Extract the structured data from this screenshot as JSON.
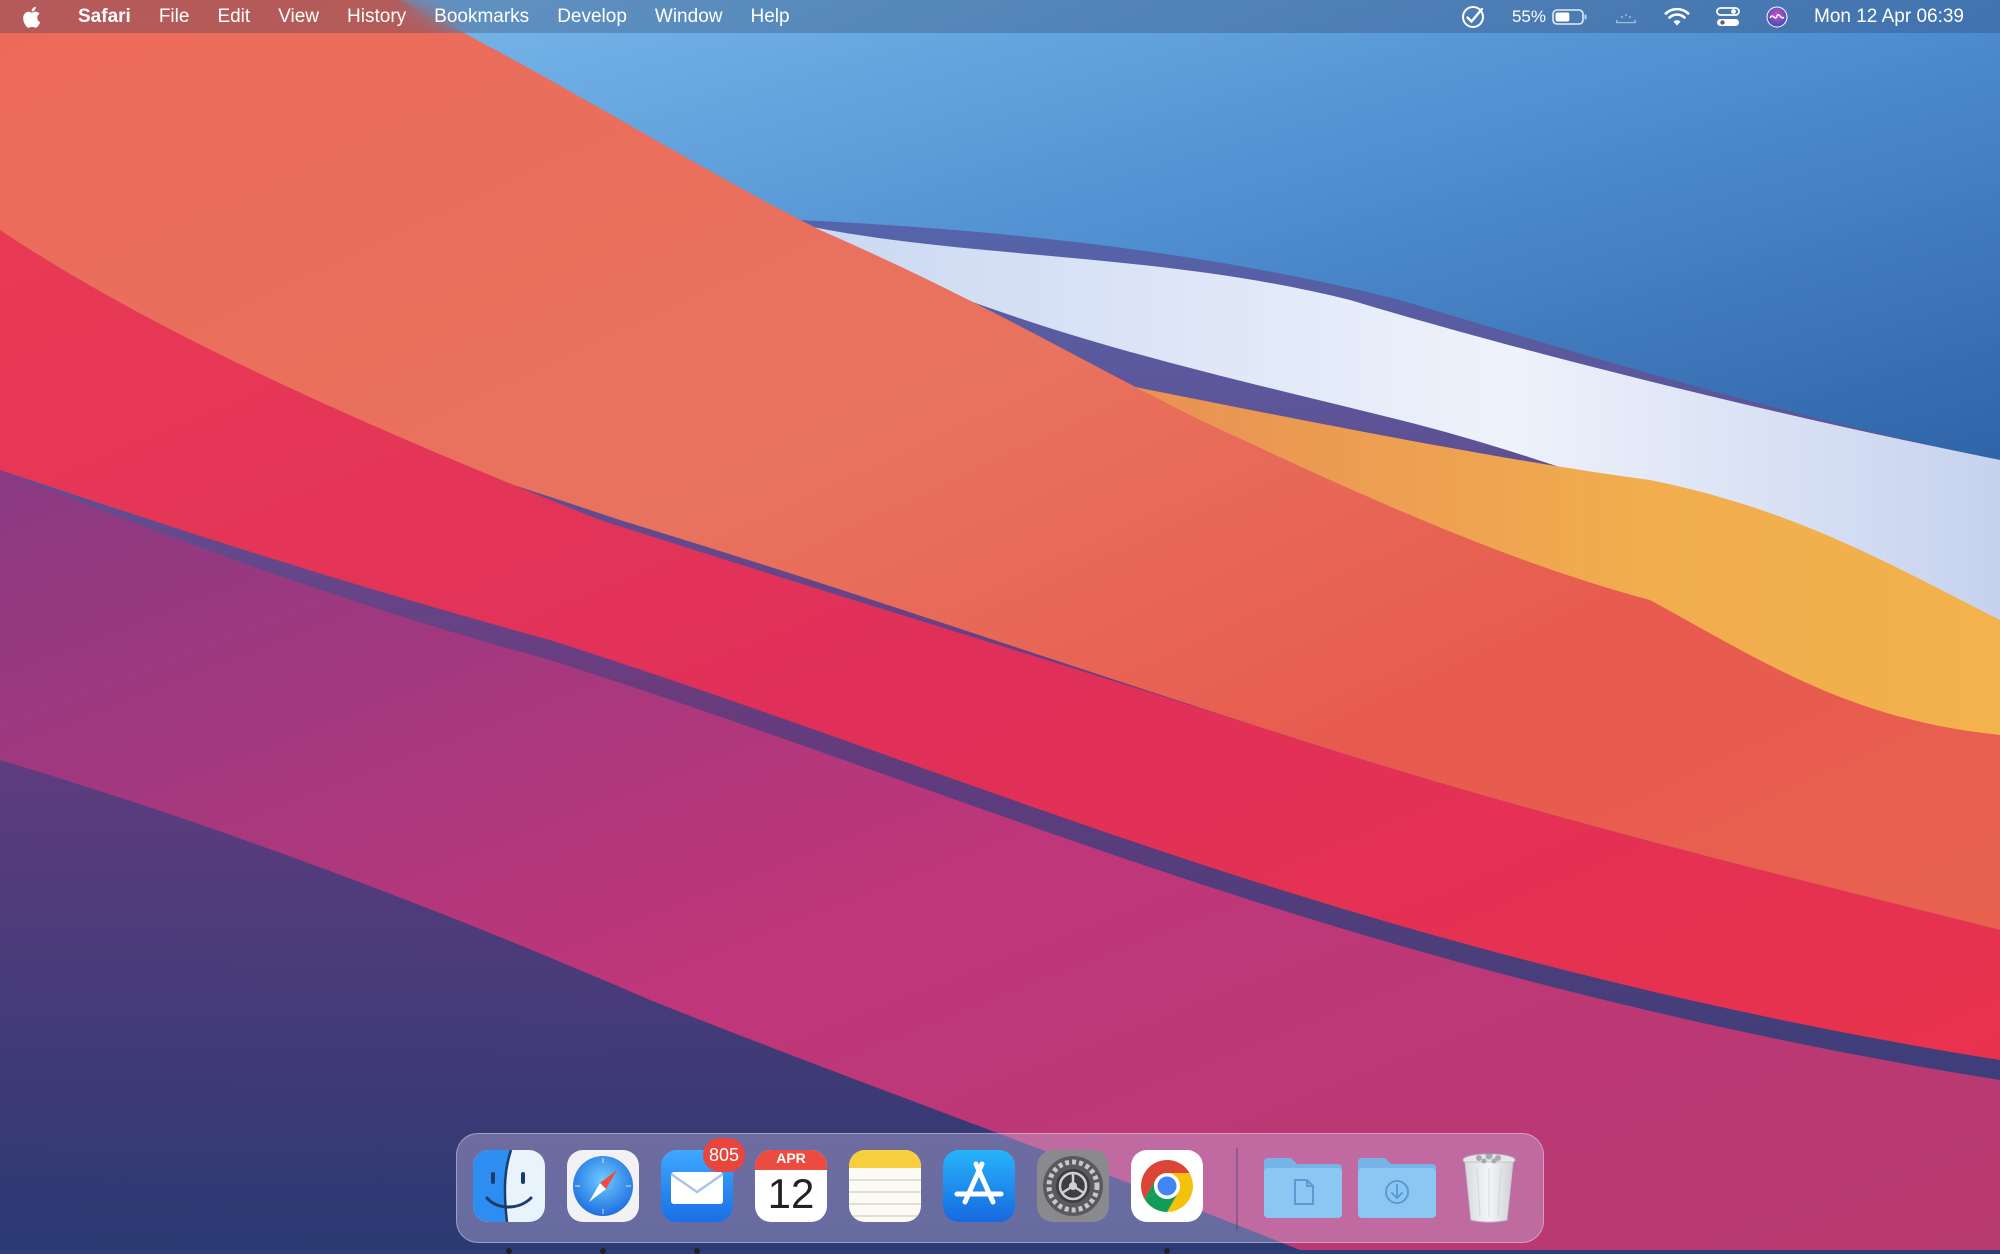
{
  "menubar": {
    "app_name": "Safari",
    "menus": [
      "File",
      "Edit",
      "View",
      "History",
      "Bookmarks",
      "Develop",
      "Window",
      "Help"
    ],
    "status": {
      "battery_percent": "55%",
      "battery_level": 0.55,
      "icons": [
        "checkmark-circle-icon",
        "battery-icon",
        "brightness-icon",
        "wifi-icon",
        "control-center-icon",
        "siri-icon"
      ],
      "clock": "Mon 12 Apr  06:39"
    }
  },
  "dock": {
    "apps": [
      {
        "name": "Finder",
        "icon": "finder-icon",
        "running": true
      },
      {
        "name": "Safari",
        "icon": "safari-icon",
        "running": true
      },
      {
        "name": "Mail",
        "icon": "mail-icon",
        "running": true,
        "badge": "805"
      },
      {
        "name": "Calendar",
        "icon": "calendar-icon",
        "running": false,
        "month": "APR",
        "day": "12"
      },
      {
        "name": "Notes",
        "icon": "notes-icon",
        "running": false
      },
      {
        "name": "App Store",
        "icon": "app-store-icon",
        "running": false
      },
      {
        "name": "System Preferences",
        "icon": "system-preferences-icon",
        "running": false
      },
      {
        "name": "Google Chrome",
        "icon": "chrome-icon",
        "running": true
      }
    ],
    "folders": [
      {
        "name": "Documents",
        "icon": "documents-folder-icon"
      },
      {
        "name": "Downloads",
        "icon": "downloads-folder-icon"
      }
    ],
    "trash": {
      "name": "Trash",
      "icon": "trash-icon"
    }
  },
  "colors": {
    "badge": "#e8463d",
    "wallpaper_red": "#e84a5a",
    "wallpaper_blue": "#3e7cc2",
    "wallpaper_orange": "#f0a64b",
    "wallpaper_purple": "#7a3a80"
  }
}
